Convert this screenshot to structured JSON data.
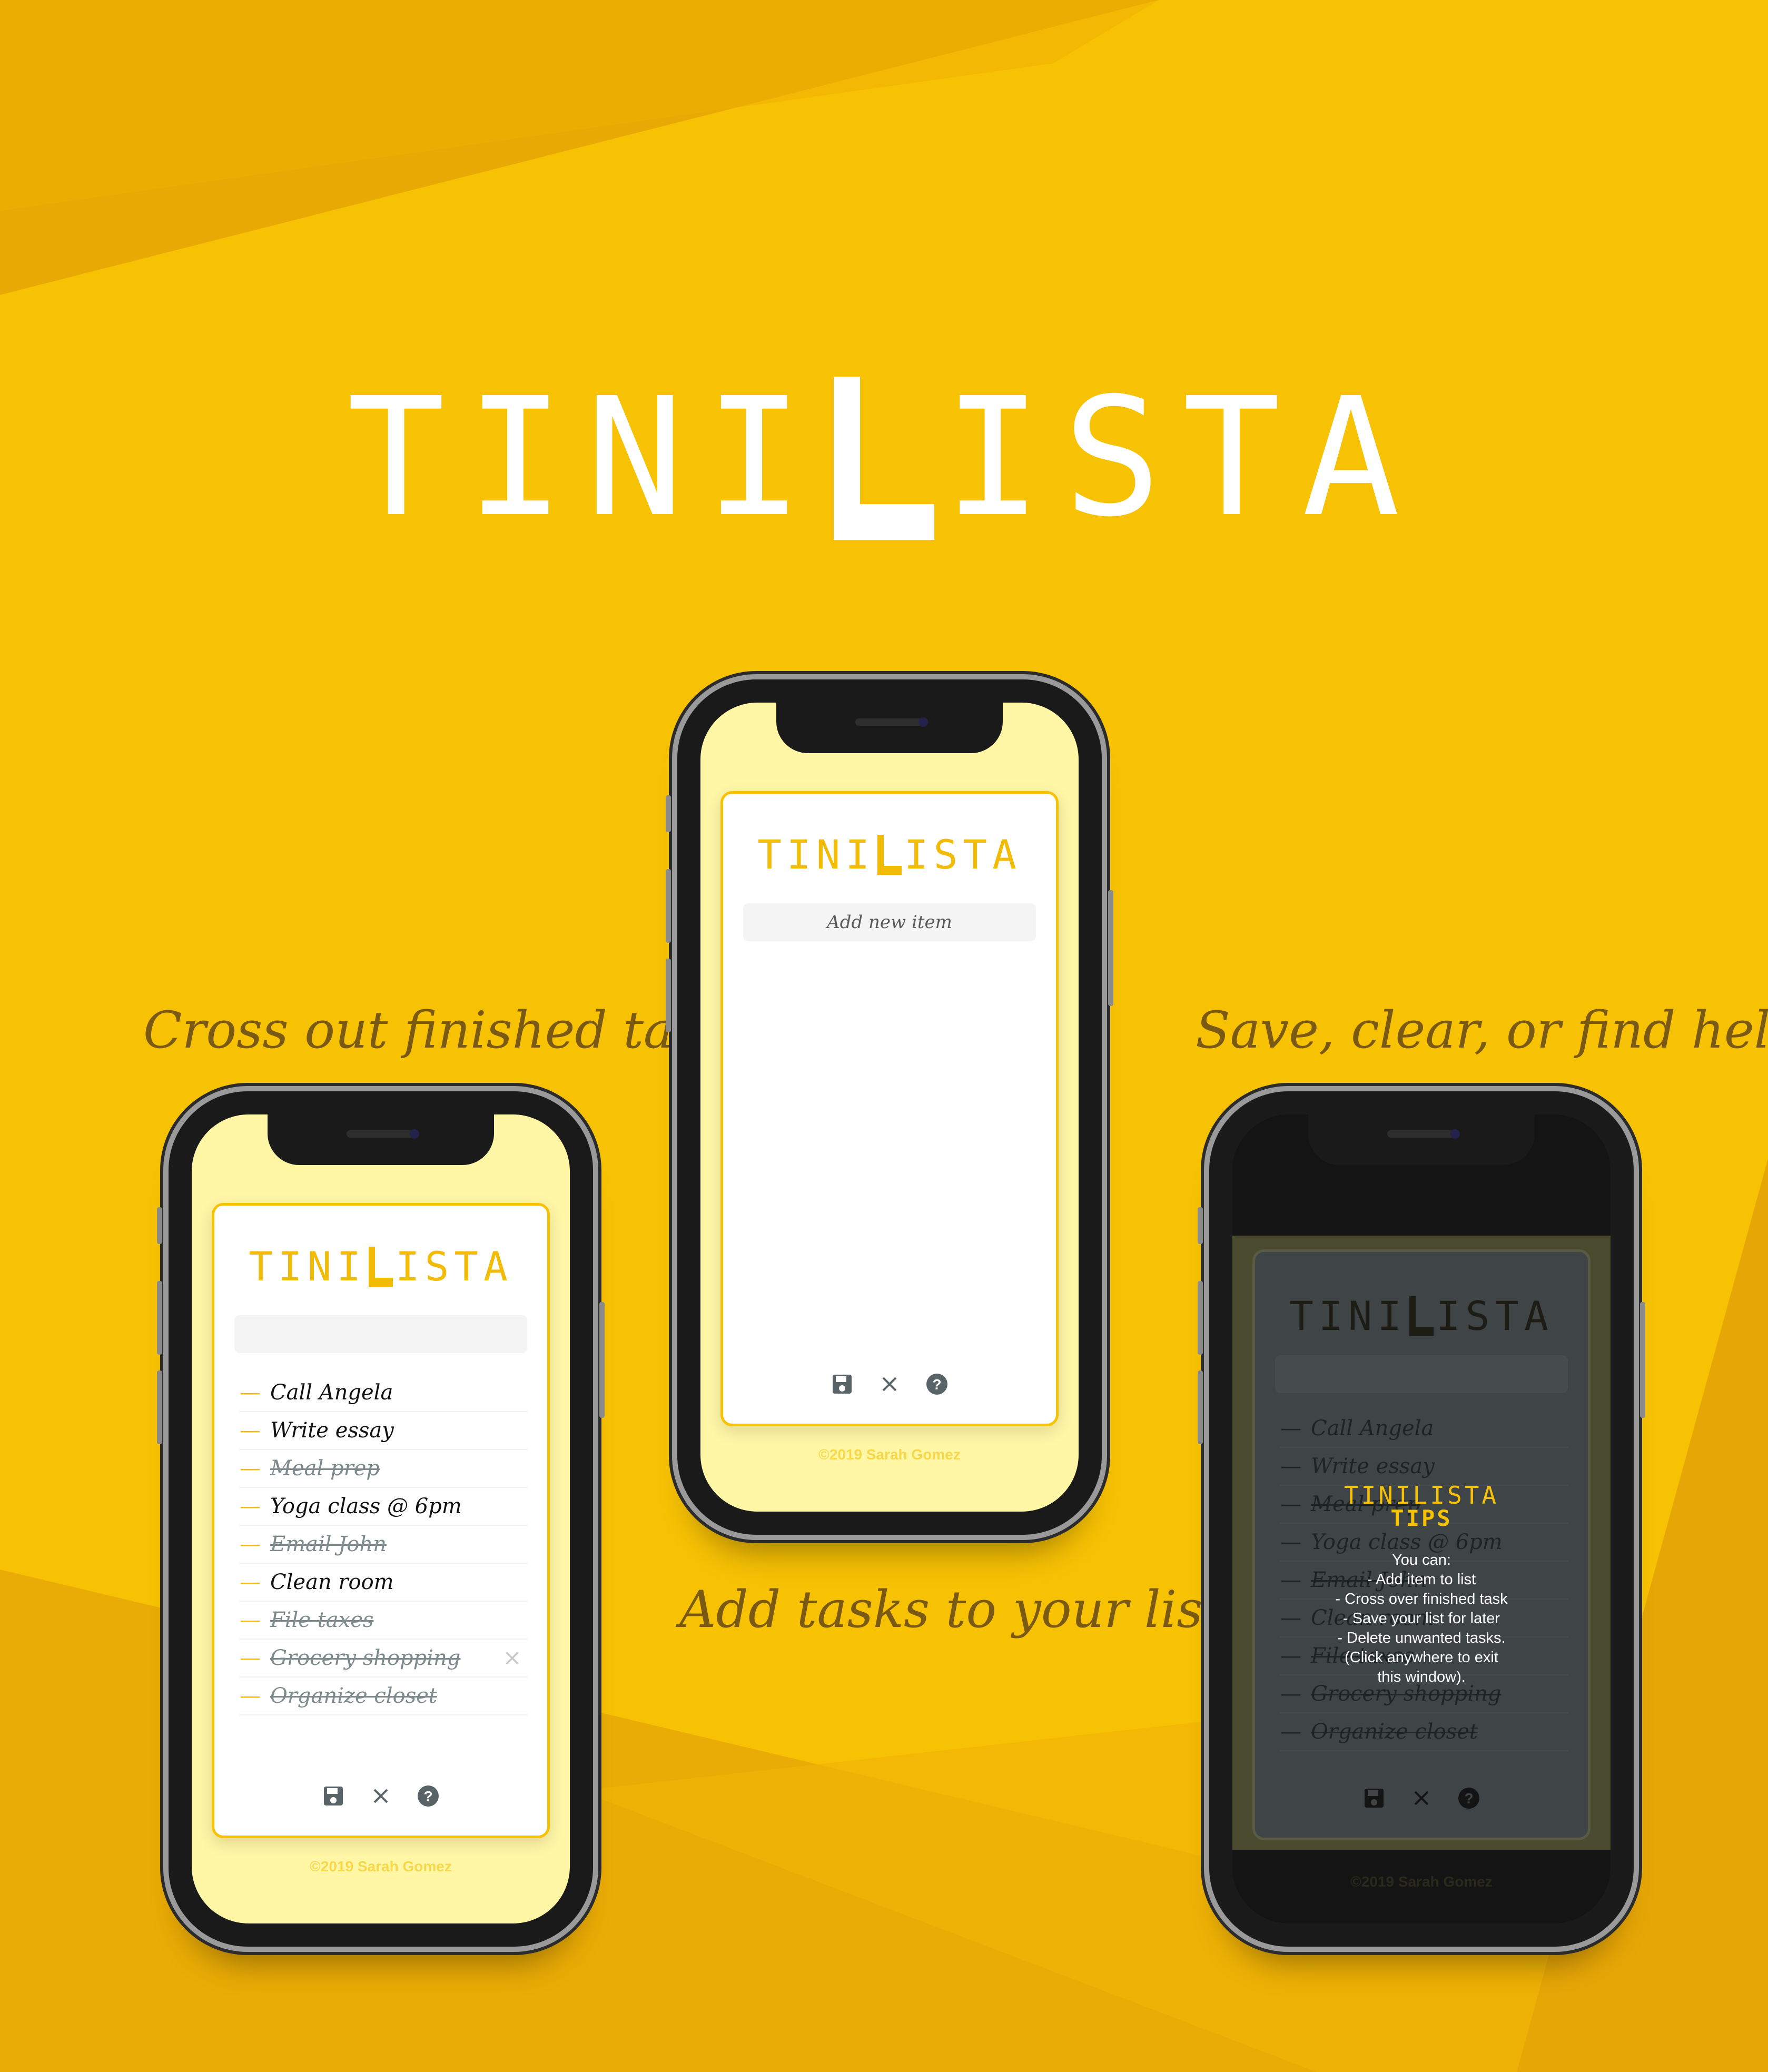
{
  "brand": {
    "name_before": "TINI",
    "name_l": "L",
    "name_after": "ISTA"
  },
  "captions": {
    "left": "Cross out finished tasks!",
    "center": "Add tasks to your list.",
    "right": "Save, clear, or find help!"
  },
  "app": {
    "input_placeholder": "Add new item",
    "footer": "©2019 Sarah Gomez",
    "tasks": [
      {
        "label": "Call Angela",
        "done": false
      },
      {
        "label": "Write essay",
        "done": false
      },
      {
        "label": "Meal prep",
        "done": true
      },
      {
        "label": "Yoga class @ 6pm",
        "done": false
      },
      {
        "label": "Email John",
        "done": true
      },
      {
        "label": "Clean room",
        "done": false
      },
      {
        "label": "File taxes",
        "done": true
      },
      {
        "label": "Grocery shopping",
        "done": true
      },
      {
        "label": "Organize closet",
        "done": true
      }
    ],
    "toolbar": {
      "save_icon": "floppy-disk-icon",
      "clear_icon": "close-icon",
      "help_icon": "question-circle-icon"
    },
    "delete_glyph": "×"
  },
  "tips": {
    "title": "TINILISTA",
    "subtitle": "TIPS",
    "intro": "You can:",
    "lines": [
      "- Add item to list",
      "- Cross over finished task",
      "- Save your list for later",
      "- Delete unwanted tasks.",
      "(Click anywhere to exit",
      "this window)."
    ]
  },
  "colors": {
    "background": "#f7c104",
    "accent": "#f2bb06",
    "screen_bg": "#fff6a6",
    "done_text": "#7c8a8c",
    "caption": "#7a5a12"
  }
}
